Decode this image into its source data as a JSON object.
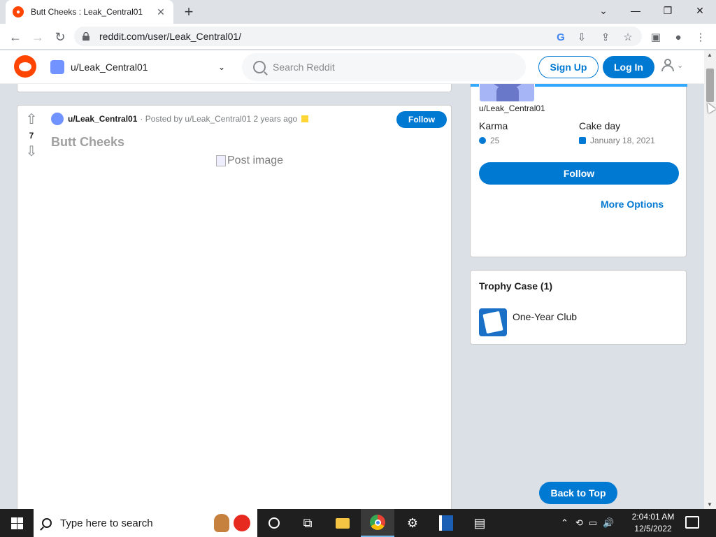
{
  "browser": {
    "tab_title": "Butt Cheeks : Leak_Central01",
    "tab_close": "✕",
    "new_tab": "+",
    "url": "reddit.com/user/Leak_Central01/",
    "window_controls": [
      "⌄",
      "—",
      "❐",
      "✕"
    ],
    "nav": {
      "back": "←",
      "forward": "→",
      "reload": "↻"
    },
    "toolbar_icons": [
      "google-icon",
      "download-icon",
      "share-icon",
      "star-icon",
      "sidebar-icon",
      "profile-icon",
      "menu-icon"
    ]
  },
  "reddit_header": {
    "community": "u/Leak_Central01",
    "search_placeholder": "Search Reddit",
    "sign_up": "Sign Up",
    "log_in": "Log In",
    "brand_color": "#ff4500",
    "accent_color": "#0079d3"
  },
  "post": {
    "score": "7",
    "author": "u/Leak_Central01",
    "posted_by": "· Posted by u/Leak_Central01 2 years ago",
    "follow": "Follow",
    "title": "Butt Cheeks",
    "image_alt": "Post image"
  },
  "profile": {
    "username": "u/Leak_Central01",
    "karma_label": "Karma",
    "karma_value": "25",
    "cakeday_label": "Cake day",
    "cakeday_value": "January 18, 2021",
    "follow": "Follow",
    "more_options": "More Options"
  },
  "trophies": {
    "title": "Trophy Case (1)",
    "items": [
      {
        "label": "One-Year Club"
      }
    ]
  },
  "back_to_top": "Back to Top",
  "taskbar": {
    "search_placeholder": "Type here to search",
    "time": "2:04:01 AM",
    "date": "12/5/2022"
  }
}
